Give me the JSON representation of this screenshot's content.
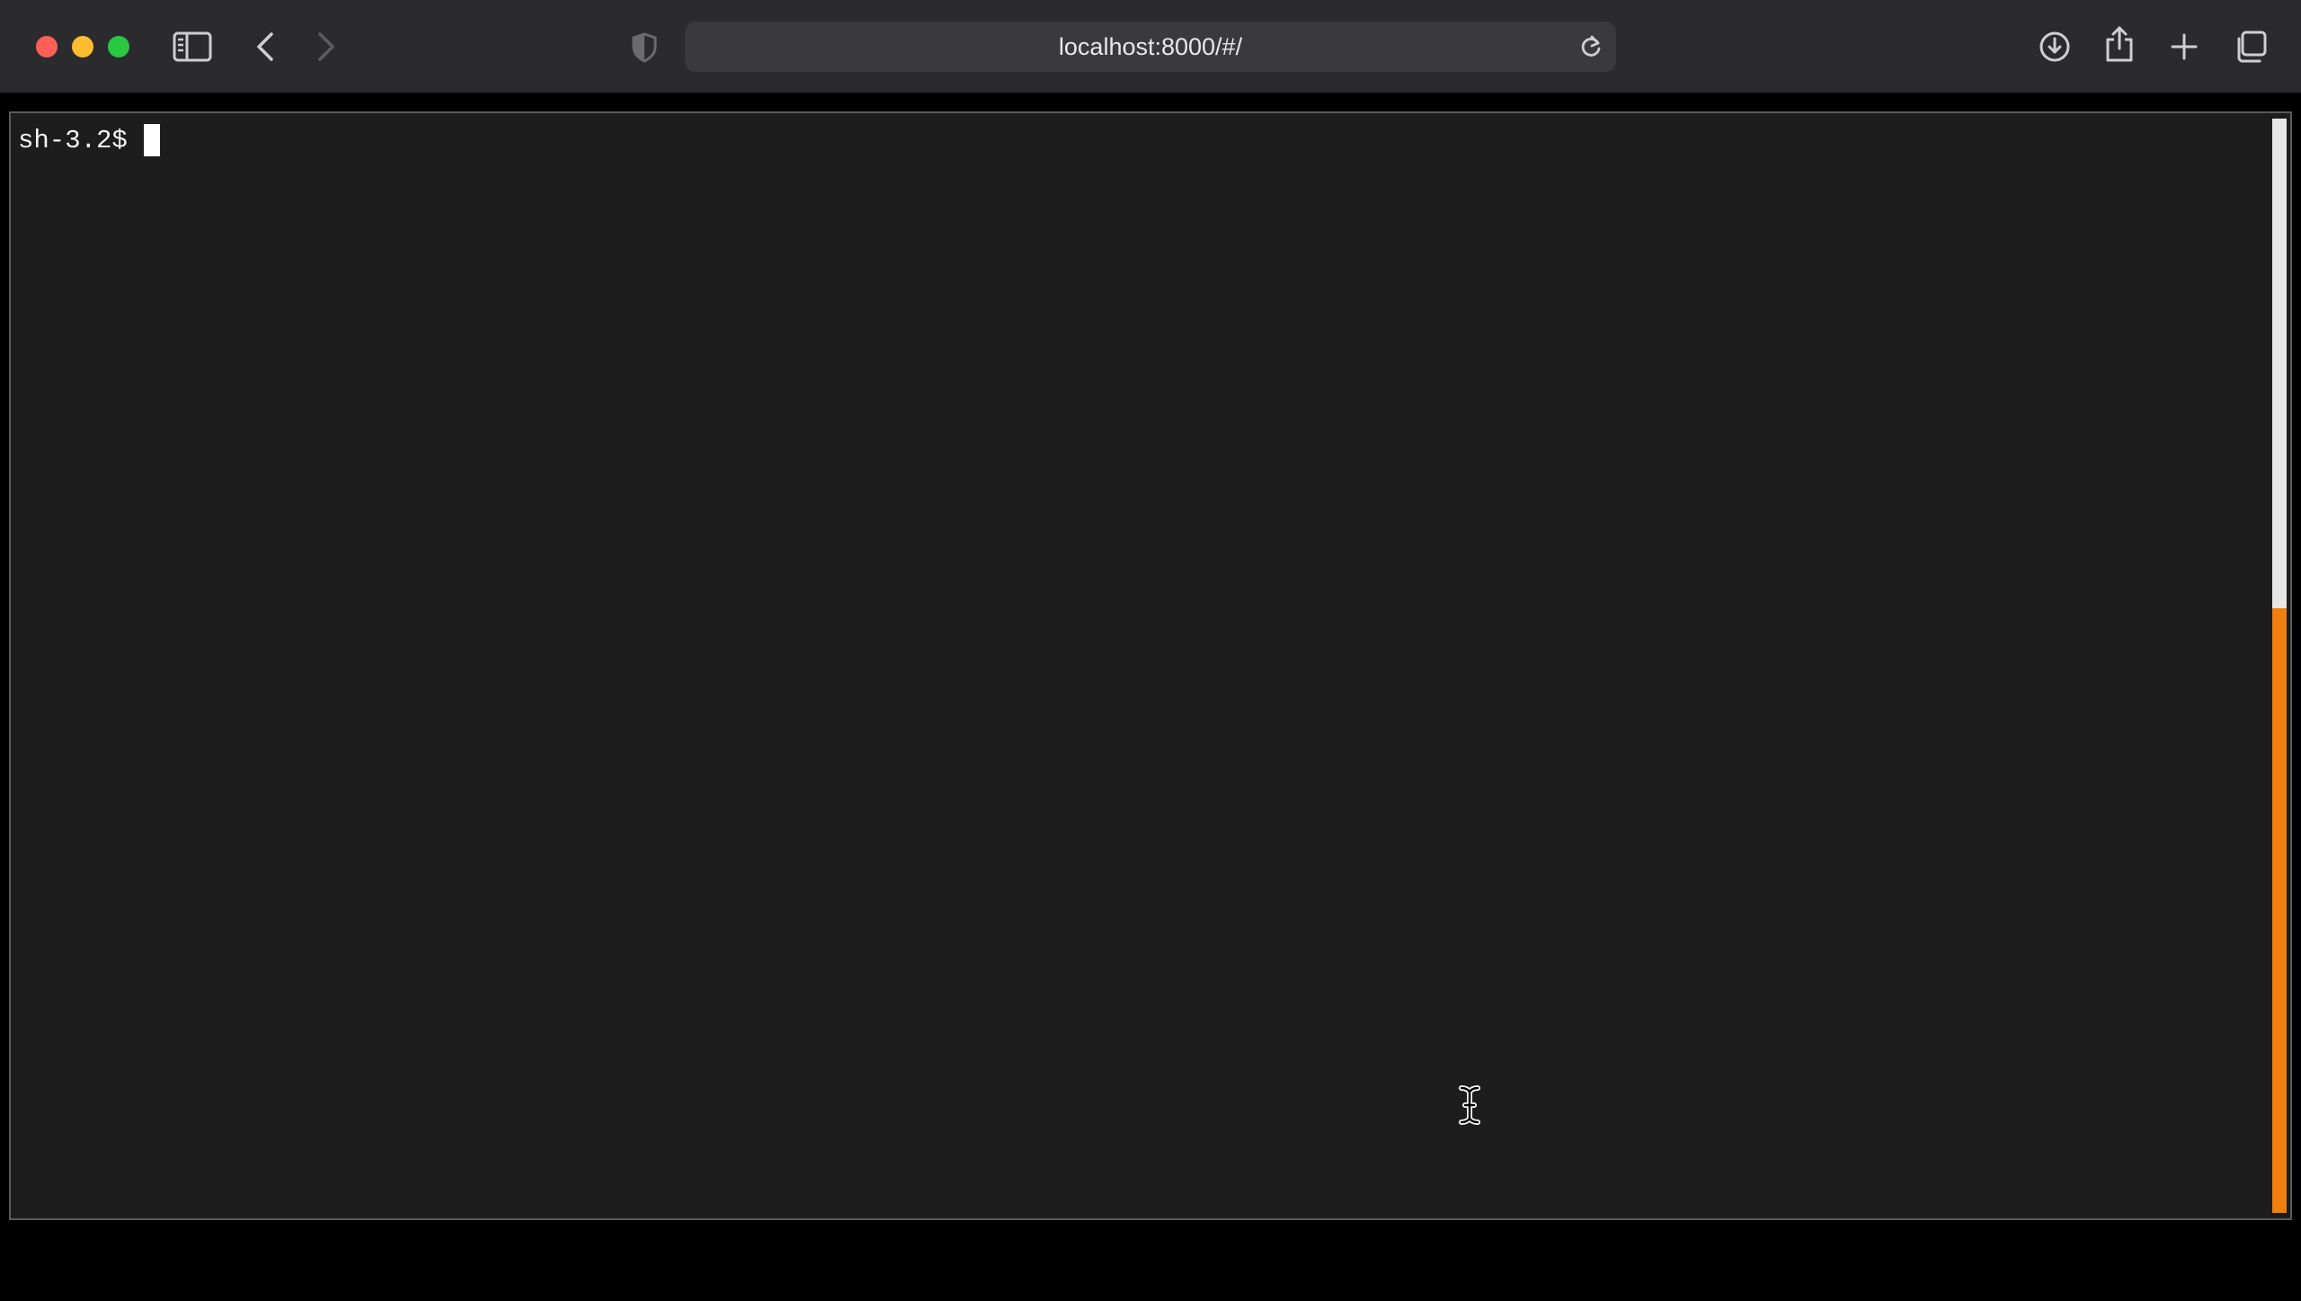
{
  "browser": {
    "address": "localhost:8000/#/"
  },
  "icons": {
    "sidebar": "sidebar-icon",
    "back": "chevron-left-icon",
    "forward": "chevron-right-icon",
    "shield": "shield-icon",
    "reload": "reload-icon",
    "download": "download-icon",
    "share": "share-icon",
    "new_tab": "plus-icon",
    "tabs": "tab-overview-icon",
    "mouse": "text-cursor-icon"
  },
  "terminal": {
    "prompt": "sh-3.2$",
    "scrollbar_accent": "#f07f10"
  },
  "colors": {
    "close": "#ff5f57",
    "minimize": "#febc2e",
    "zoom": "#28c840"
  }
}
